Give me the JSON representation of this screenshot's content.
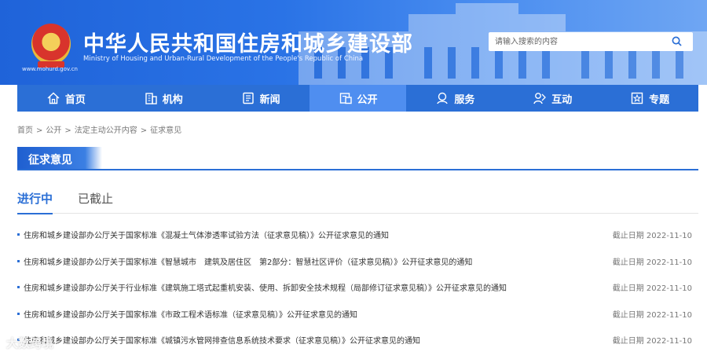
{
  "header": {
    "title_cn": "中华人民共和国住房和城乡建设部",
    "title_en": "Ministry of Housing and Urban-Rural Development of the People's Republic of China",
    "site_url": "www.mohurd.gov.cn",
    "search_placeholder": "请输入搜索的内容",
    "emblem_icon": "national-emblem-icon",
    "search_icon": "search-icon"
  },
  "nav": {
    "items": [
      {
        "label": "首页",
        "icon": "home-icon",
        "active": false
      },
      {
        "label": "机构",
        "icon": "building-icon",
        "active": false
      },
      {
        "label": "新闻",
        "icon": "news-icon",
        "active": false
      },
      {
        "label": "公开",
        "icon": "document-icon",
        "active": true
      },
      {
        "label": "服务",
        "icon": "service-icon",
        "active": false
      },
      {
        "label": "互动",
        "icon": "interact-icon",
        "active": false
      },
      {
        "label": "专题",
        "icon": "star-icon",
        "active": false
      }
    ],
    "colors": {
      "bar": "#2b6fd6",
      "active": "#4f8ef0"
    }
  },
  "breadcrumb": [
    "首页",
    "公开",
    "法定主动公开内容",
    "征求意见"
  ],
  "section_title": "征求意见",
  "tabs": [
    {
      "label": "进行中",
      "active": true
    },
    {
      "label": "已截止",
      "active": false
    }
  ],
  "notices": [
    {
      "title": "住房和城乡建设部办公厅关于国家标准《混凝土气体渗透率试验方法（征求意见稿）》公开征求意见的通知",
      "deadline": "截止日期 2022-11-10"
    },
    {
      "title": "住房和城乡建设部办公厅关于国家标准《智慧城市　建筑及居住区　第2部分：智慧社区评价（征求意见稿）》公开征求意见的通知",
      "deadline": "截止日期 2022-11-10"
    },
    {
      "title": "住房和城乡建设部办公厅关于行业标准《建筑施工塔式起重机安装、使用、拆卸安全技术规程（局部修订征求意见稿）》公开征求意见的通知",
      "deadline": "截止日期 2022-11-10"
    },
    {
      "title": "住房和城乡建设部办公厅关于国家标准《市政工程术语标准（征求意见稿）》公开征求意见的通知",
      "deadline": "截止日期 2022-11-10"
    },
    {
      "title": "住房和城乡建设部办公厅关于国家标准《城镇污水管网排查信息系统技术要求（征求意见稿）》公开征求意见的通知",
      "deadline": "截止日期 2022-11-10"
    }
  ],
  "watermark": "大数跨境",
  "accent_color": "#2b6fd6"
}
